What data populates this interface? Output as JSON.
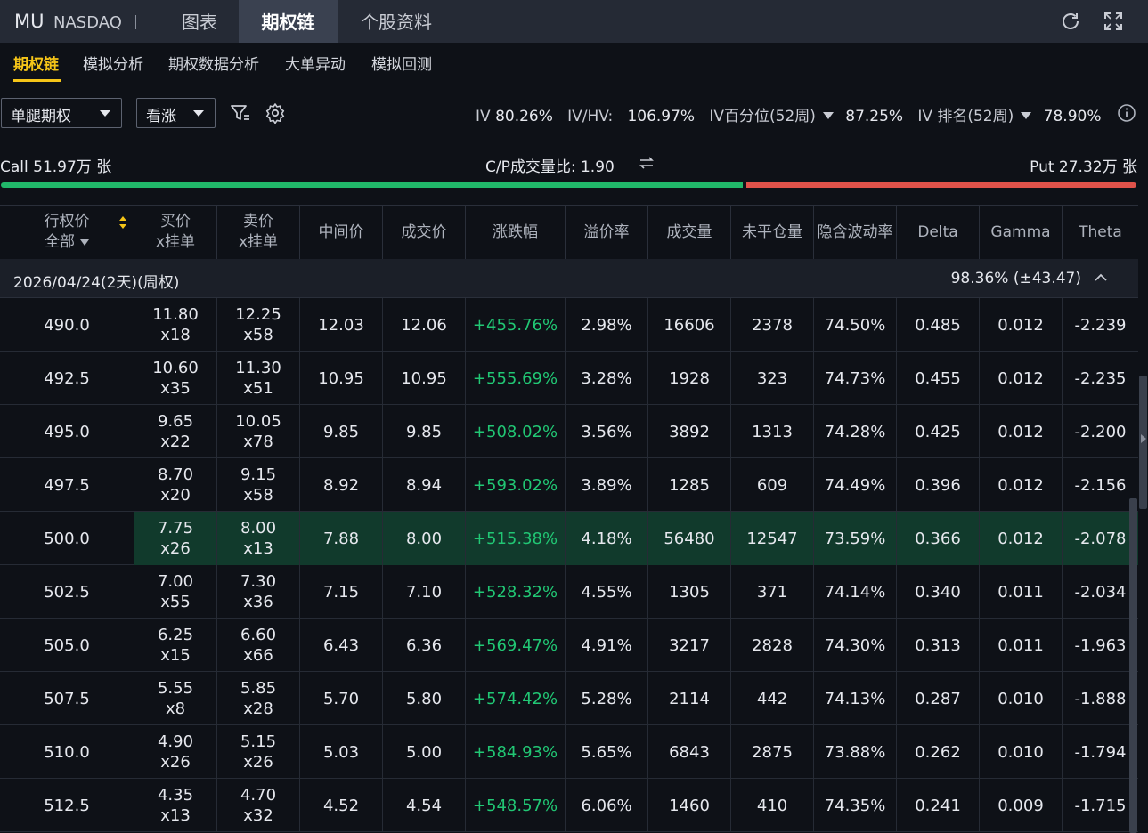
{
  "header": {
    "ticker": "MU",
    "exchange": "NASDAQ",
    "tabs": [
      "图表",
      "期权链",
      "个股资料"
    ],
    "active_tab": 1
  },
  "subtabs": [
    "期权链",
    "模拟分析",
    "期权数据分析",
    "大单异动",
    "模拟回测"
  ],
  "filters": {
    "strategy": "单腿期权",
    "direction": "看涨"
  },
  "iv_bar": {
    "iv_label": "IV",
    "iv_value": "80.26%",
    "ivhv_label": "IV/HV:",
    "ivhv_value": "106.97%",
    "iv_pct_label": "IV百分位(52周)",
    "iv_pct_value": "87.25%",
    "iv_rank_label": "IV 排名(52周)",
    "iv_rank_value": "78.90%"
  },
  "cp": {
    "call_label": "Call 51.97万 张",
    "ratio_label": "C/P成交量比:",
    "ratio_value": "1.90",
    "put_label": "Put 27.32万 张",
    "call_share": 0.655,
    "colors": {
      "call": "#21b86a",
      "put": "#e0524a"
    }
  },
  "table": {
    "headers": {
      "strike": "行权价",
      "strike_filter": "全部",
      "bid_1": "买价",
      "bid_2": "x挂单",
      "ask_1": "卖价",
      "ask_2": "x挂单",
      "mid": "中间价",
      "last": "成交价",
      "change": "涨跌幅",
      "premium": "溢价率",
      "volume": "成交量",
      "oi": "未平仓量",
      "iv": "隐含波动率",
      "delta": "Delta",
      "gamma": "Gamma",
      "theta": "Theta"
    },
    "group": {
      "date": "2026/04/24(2天)(周权)",
      "iv": "98.36% (±43.47)"
    },
    "rows": [
      {
        "strike": "490.0",
        "bid": "11.80",
        "bid_size": "x18",
        "ask": "12.25",
        "ask_size": "x58",
        "mid": "12.03",
        "last": "12.06",
        "change": "+455.76%",
        "premium": "2.98%",
        "volume": "16606",
        "oi": "2378",
        "iv": "74.50%",
        "delta": "0.485",
        "gamma": "0.012",
        "theta": "-2.239"
      },
      {
        "strike": "492.5",
        "bid": "10.60",
        "bid_size": "x35",
        "ask": "11.30",
        "ask_size": "x51",
        "mid": "10.95",
        "last": "10.95",
        "change": "+555.69%",
        "premium": "3.28%",
        "volume": "1928",
        "oi": "323",
        "iv": "74.73%",
        "delta": "0.455",
        "gamma": "0.012",
        "theta": "-2.235"
      },
      {
        "strike": "495.0",
        "bid": "9.65",
        "bid_size": "x22",
        "ask": "10.05",
        "ask_size": "x78",
        "mid": "9.85",
        "last": "9.85",
        "change": "+508.02%",
        "premium": "3.56%",
        "volume": "3892",
        "oi": "1313",
        "iv": "74.28%",
        "delta": "0.425",
        "gamma": "0.012",
        "theta": "-2.200"
      },
      {
        "strike": "497.5",
        "bid": "8.70",
        "bid_size": "x20",
        "ask": "9.15",
        "ask_size": "x58",
        "mid": "8.92",
        "last": "8.94",
        "change": "+593.02%",
        "premium": "3.89%",
        "volume": "1285",
        "oi": "609",
        "iv": "74.49%",
        "delta": "0.396",
        "gamma": "0.012",
        "theta": "-2.156"
      },
      {
        "strike": "500.0",
        "bid": "7.75",
        "bid_size": "x26",
        "ask": "8.00",
        "ask_size": "x13",
        "mid": "7.88",
        "last": "8.00",
        "change": "+515.38%",
        "premium": "4.18%",
        "volume": "56480",
        "oi": "12547",
        "iv": "73.59%",
        "delta": "0.366",
        "gamma": "0.012",
        "theta": "-2.078"
      },
      {
        "strike": "502.5",
        "bid": "7.00",
        "bid_size": "x55",
        "ask": "7.30",
        "ask_size": "x36",
        "mid": "7.15",
        "last": "7.10",
        "change": "+528.32%",
        "premium": "4.55%",
        "volume": "1305",
        "oi": "371",
        "iv": "74.14%",
        "delta": "0.340",
        "gamma": "0.011",
        "theta": "-2.034"
      },
      {
        "strike": "505.0",
        "bid": "6.25",
        "bid_size": "x15",
        "ask": "6.60",
        "ask_size": "x66",
        "mid": "6.43",
        "last": "6.36",
        "change": "+569.47%",
        "premium": "4.91%",
        "volume": "3217",
        "oi": "2828",
        "iv": "74.30%",
        "delta": "0.313",
        "gamma": "0.011",
        "theta": "-1.963"
      },
      {
        "strike": "507.5",
        "bid": "5.55",
        "bid_size": "x8",
        "ask": "5.85",
        "ask_size": "x28",
        "mid": "5.70",
        "last": "5.80",
        "change": "+574.42%",
        "premium": "5.28%",
        "volume": "2114",
        "oi": "442",
        "iv": "74.13%",
        "delta": "0.287",
        "gamma": "0.010",
        "theta": "-1.888"
      },
      {
        "strike": "510.0",
        "bid": "4.90",
        "bid_size": "x26",
        "ask": "5.15",
        "ask_size": "x26",
        "mid": "5.03",
        "last": "5.00",
        "change": "+584.93%",
        "premium": "5.65%",
        "volume": "6843",
        "oi": "2875",
        "iv": "73.88%",
        "delta": "0.262",
        "gamma": "0.010",
        "theta": "-1.794"
      },
      {
        "strike": "512.5",
        "bid": "4.35",
        "bid_size": "x13",
        "ask": "4.70",
        "ask_size": "x32",
        "mid": "4.52",
        "last": "4.54",
        "change": "+548.57%",
        "premium": "6.06%",
        "volume": "1460",
        "oi": "410",
        "iv": "74.35%",
        "delta": "0.241",
        "gamma": "0.009",
        "theta": "-1.715"
      }
    ],
    "atm_index": 4,
    "colors": {
      "up": "#21c774",
      "atm_bg": "#113a2c"
    }
  }
}
